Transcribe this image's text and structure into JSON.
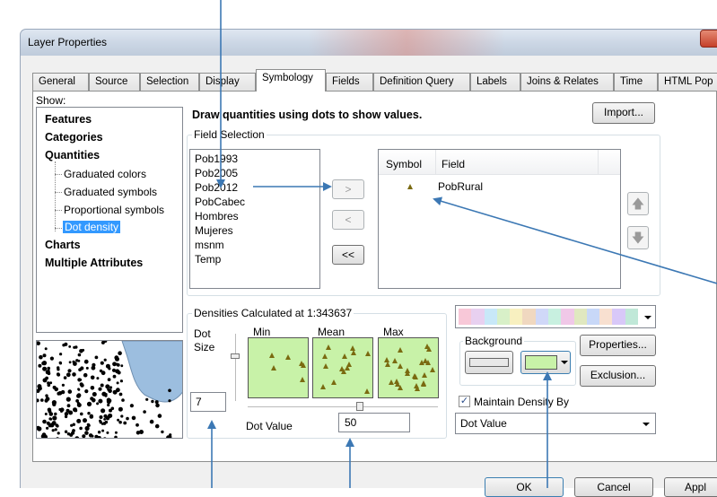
{
  "window": {
    "title": "Layer Properties"
  },
  "tabs": [
    {
      "label": "General"
    },
    {
      "label": "Source"
    },
    {
      "label": "Selection"
    },
    {
      "label": "Display"
    },
    {
      "label": "Symbology"
    },
    {
      "label": "Fields"
    },
    {
      "label": "Definition Query"
    },
    {
      "label": "Labels"
    },
    {
      "label": "Joins & Relates"
    },
    {
      "label": "Time"
    },
    {
      "label": "HTML Pop"
    }
  ],
  "show": {
    "label": "Show:",
    "features": "Features",
    "categories": "Categories",
    "quantities": "Quantities",
    "sub": [
      "Graduated colors",
      "Graduated symbols",
      "Proportional symbols",
      "Dot density"
    ],
    "charts": "Charts",
    "multiple": "Multiple Attributes"
  },
  "header": {
    "text": "Draw quantities using dots to show values.",
    "import_label": "Import..."
  },
  "field_selection": {
    "label": "Field Selection",
    "fields": [
      "Pob1993",
      "Pob2005",
      "Pob2012",
      "PobCabec",
      "Hombres",
      "Mujeres",
      "msnm",
      "Temp"
    ],
    "add_label": ">",
    "remove_label": "<",
    "remove_all_label": "<<",
    "col_symbol": "Symbol",
    "col_field": "Field",
    "selected_field": "PobRural"
  },
  "densities": {
    "label": "Densities Calculated at 1:343637",
    "dot_size_label": "Dot\nSize",
    "min": "Min",
    "mean": "Mean",
    "max": "Max",
    "dot_size_value": "7",
    "dot_value_label": "Dot Value",
    "dot_value": "50"
  },
  "background": {
    "label": "Background",
    "properties_label": "Properties...",
    "exclusion_label": "Exclusion...",
    "maintain_label": "Maintain Density By",
    "maintain_checked": true,
    "maintain_value": "Dot Value",
    "fill_color": "#c8f2a8"
  },
  "footer": {
    "ok": "OK",
    "cancel": "Cancel",
    "apply": "Appl"
  },
  "colors": {
    "accent": "#3c78b4",
    "dot_fill": "#c8f2a8",
    "selection": "#3399ff"
  }
}
